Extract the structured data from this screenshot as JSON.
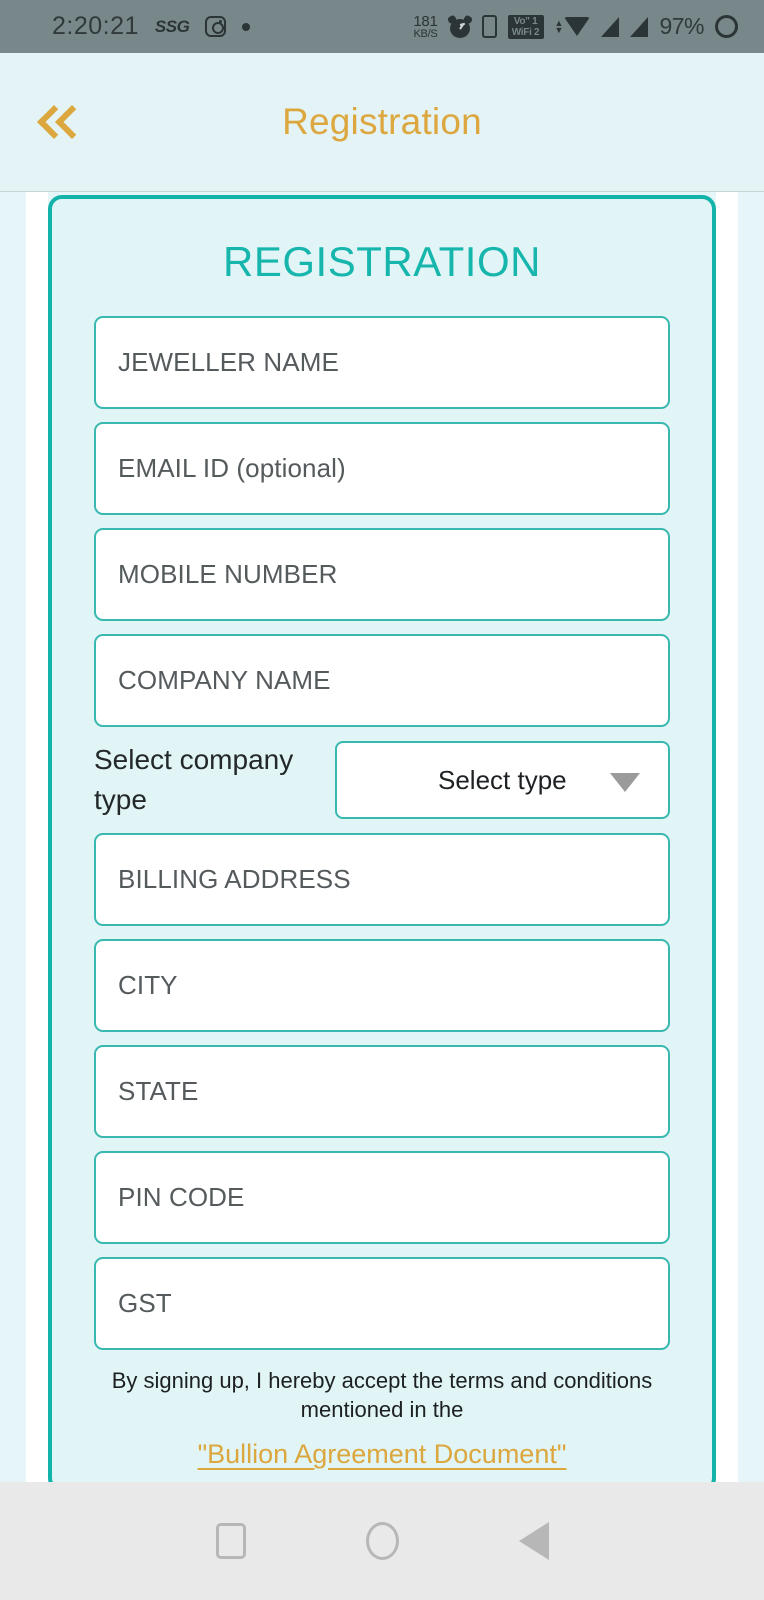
{
  "status_bar": {
    "time": "2:20:21",
    "carrier": "SSG",
    "instagram_icon": "instagram-icon",
    "dot_icon": "dot-icon",
    "network_speed_value": "181",
    "network_speed_unit": "KB/S",
    "alarm_icon": "alarm-icon",
    "phone_icon": "phone-icon",
    "vowifi_line1": "Vo\"  1",
    "vowifi_line2": "WiFi 2",
    "wifi_icon": "wifi-icon",
    "signal_icon_1": "signal-bars-icon",
    "signal_icon_2": "signal-bars-icon",
    "battery_percent": "97%",
    "battery_icon": "battery-ring-icon",
    "background_color": "#78878a",
    "foreground_color": "#2b3436"
  },
  "app_bar": {
    "back_icon": "double-chevron-left-icon",
    "title": "Registration",
    "title_color": "#dca73f",
    "background_color": "#e4f4f6"
  },
  "card": {
    "heading": "REGISTRATION",
    "heading_color": "#16b6ad",
    "border_color": "#14b3aa",
    "background_color": "#e1f4f6",
    "fields": [
      {
        "name": "jeweller-name",
        "placeholder": "JEWELLER NAME"
      },
      {
        "name": "email-id",
        "placeholder": "EMAIL ID (optional)"
      },
      {
        "name": "mobile-number",
        "placeholder": "MOBILE NUMBER"
      },
      {
        "name": "company-name",
        "placeholder": "COMPANY NAME"
      }
    ],
    "company_type": {
      "label": "Select company type",
      "selected_value": "Select type",
      "caret_icon": "chevron-down-icon"
    },
    "fields_after": [
      {
        "name": "billing-address",
        "placeholder": "BILLING ADDRESS"
      },
      {
        "name": "city",
        "placeholder": "CITY"
      },
      {
        "name": "state",
        "placeholder": "STATE"
      },
      {
        "name": "pin-code",
        "placeholder": "PIN CODE"
      },
      {
        "name": "gst",
        "placeholder": "GST"
      }
    ],
    "terms_text": "By signing up, I hereby accept the terms and conditions mentioned in the",
    "document_link": "\"Bullion Agreement Document\"",
    "document_link_color": "#dca73f"
  },
  "nav_bar": {
    "recents_icon": "square-recents-icon",
    "home_icon": "circle-home-icon",
    "back_icon": "triangle-back-icon",
    "background_color": "#e9e9e9"
  }
}
